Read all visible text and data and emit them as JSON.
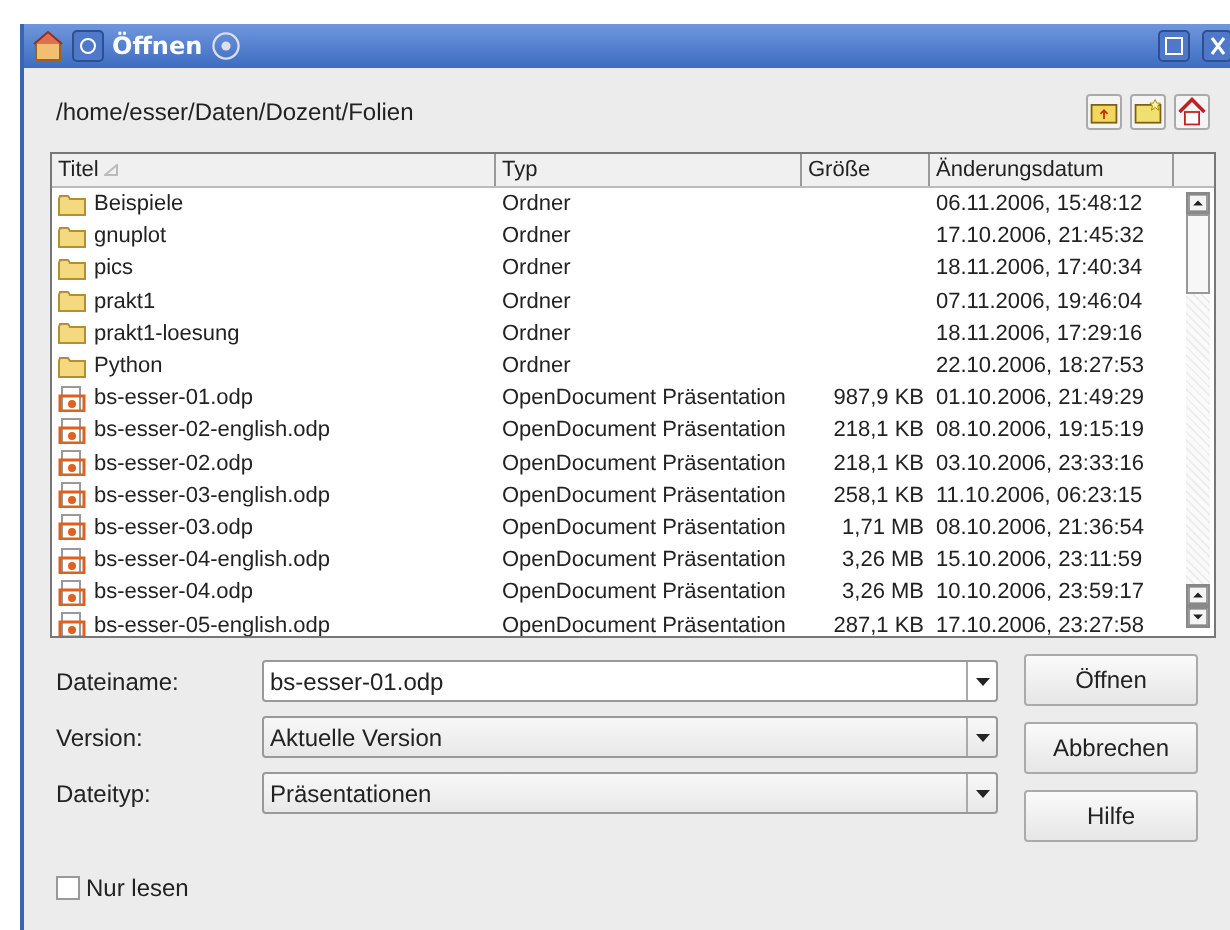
{
  "window": {
    "title": "Öffnen"
  },
  "path": "/home/esser/Daten/Dozent/Folien",
  "table": {
    "columns": [
      "Titel",
      "Typ",
      "Größe",
      "Änderungsdatum"
    ],
    "rows": [
      {
        "kind": "folder",
        "title": "Beispiele",
        "type": "Ordner",
        "date": "06.11.2006, 15:48:12",
        "selected": false
      },
      {
        "kind": "folder",
        "title": "gnuplot",
        "type": "Ordner",
        "date": "17.10.2006, 21:45:32",
        "selected": false
      },
      {
        "kind": "folder",
        "title": "pics",
        "type": "Ordner",
        "date": "18.11.2006, 17:40:34",
        "selected": false
      },
      {
        "kind": "folder",
        "title": "prakt1",
        "type": "Ordner",
        "date": "07.11.2006, 19:46:04",
        "selected": false
      },
      {
        "kind": "folder",
        "title": "prakt1-loesung",
        "type": "Ordner",
        "date": "18.11.2006, 17:29:16",
        "selected": false
      },
      {
        "kind": "folder",
        "title": "Python",
        "type": "Ordner",
        "date": "22.10.2006, 18:27:53",
        "selected": false
      },
      {
        "kind": "document",
        "title": "bs-esser-01.odp",
        "type": "OpenDocument Präsentation",
        "size": "987,9 KB",
        "date": "01.10.2006, 21:49:29",
        "selected": false
      },
      {
        "kind": "document",
        "title": "bs-esser-02-english.odp",
        "type": "OpenDocument Präsentation",
        "size": "218,1 KB",
        "date": "08.10.2006, 19:15:19",
        "selected": false
      },
      {
        "kind": "document",
        "title": "bs-esser-02.odp",
        "type": "OpenDocument Präsentation",
        "size": "218,1 KB",
        "date": "03.10.2006, 23:33:16",
        "selected": false
      },
      {
        "kind": "document",
        "title": "bs-esser-03-english.odp",
        "type": "OpenDocument Präsentation",
        "size": "258,1 KB",
        "date": "11.10.2006, 06:23:15",
        "selected": false
      },
      {
        "kind": "document",
        "title": "bs-esser-03.odp",
        "type": "OpenDocument Präsentation",
        "size": "1,71 MB",
        "date": "08.10.2006, 21:36:54",
        "selected": false
      },
      {
        "kind": "document",
        "title": "bs-esser-04-english.odp",
        "type": "OpenDocument Präsentation",
        "size": "3,26 MB",
        "date": "15.10.2006, 23:11:59",
        "selected": false
      },
      {
        "kind": "document",
        "title": "bs-esser-04.odp",
        "type": "OpenDocument Präsentation",
        "size": "3,26 MB",
        "date": "10.10.2006, 23:59:17",
        "selected": false
      },
      {
        "kind": "document",
        "title": "bs-esser-05-english.odp",
        "type": "OpenDocument Präsentation",
        "size": "287,1 KB",
        "date": "17.10.2006, 23:27:58",
        "selected": false
      }
    ]
  },
  "fields": [
    {
      "label": "Dateiname:",
      "kind": "combo-input",
      "value": "bs-esser-01.odp"
    },
    {
      "label": "Version:",
      "kind": "dropdown",
      "value": "Aktuelle Version"
    },
    {
      "label": "Dateityp:",
      "kind": "dropdown",
      "value": "Präsentationen"
    }
  ],
  "buttons": [
    "Öffnen",
    "Abbrechen",
    "Hilfe"
  ],
  "read_only": {
    "label": "Nur lesen",
    "checked": false
  }
}
